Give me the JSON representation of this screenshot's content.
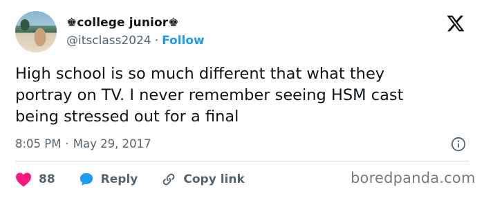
{
  "author": {
    "display_name": "♚college junior♚",
    "handle": "@itsclass2024",
    "separator": "·",
    "follow_label": "Follow"
  },
  "tweet": {
    "lines": [
      "High school is so much different that what they",
      "portray on TV. I never remember seeing HSM cast",
      "being stressed out for a final"
    ],
    "time": "8:05 PM",
    "separator": "·",
    "date": "May 29, 2017"
  },
  "actions": {
    "like_count": "88",
    "reply_label": "Reply",
    "copy_link_label": "Copy link"
  },
  "icons": {
    "platform": "x-logo-icon",
    "info": "info-icon",
    "like": "heart-icon",
    "reply": "speech-bubble-icon",
    "link": "link-icon"
  },
  "colors": {
    "like": "#f91880",
    "reply": "#1d9bf0",
    "follow": "#1d9bf0",
    "muted": "#536471"
  },
  "watermark": "boredpanda.com"
}
